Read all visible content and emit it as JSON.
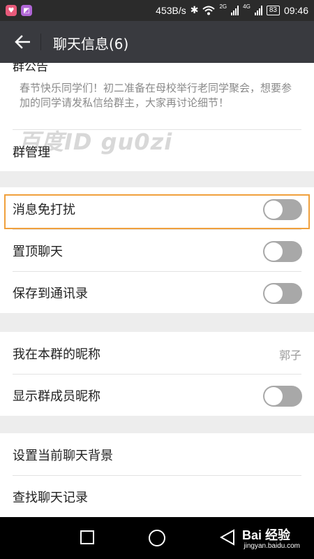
{
  "status_bar": {
    "network_speed": "453B/s",
    "sim1_label": "2G",
    "sim2_label": "4G",
    "battery": "83",
    "time": "09:46"
  },
  "header": {
    "back_icon": "arrow-left-icon",
    "title": "聊天信息(6)"
  },
  "notice": {
    "title": "群公告",
    "text": "春节快乐同学们！初二准备在母校举行老同学聚会，想要参加的同学请发私信给群主，大家再讨论细节！"
  },
  "watermark": "百度ID gu0zi",
  "rows": {
    "group_manage": {
      "label": "群管理"
    },
    "mute": {
      "label": "消息免打扰",
      "on": false
    },
    "pin": {
      "label": "置顶聊天",
      "on": false
    },
    "save_contacts": {
      "label": "保存到通讯录",
      "on": false
    },
    "nickname": {
      "label": "我在本群的昵称",
      "value": "郭子"
    },
    "show_nicknames": {
      "label": "显示群成员昵称",
      "on": false
    },
    "background": {
      "label": "设置当前聊天背景"
    },
    "search_history": {
      "label": "查找聊天记录"
    }
  },
  "nav_bar": {
    "brand": "Bai 经验",
    "url": "jingyan.baidu.com"
  },
  "colors": {
    "titlebar": "#393a3f",
    "highlight": "#f0a03c",
    "toggle_off": "#a8a8a8"
  }
}
